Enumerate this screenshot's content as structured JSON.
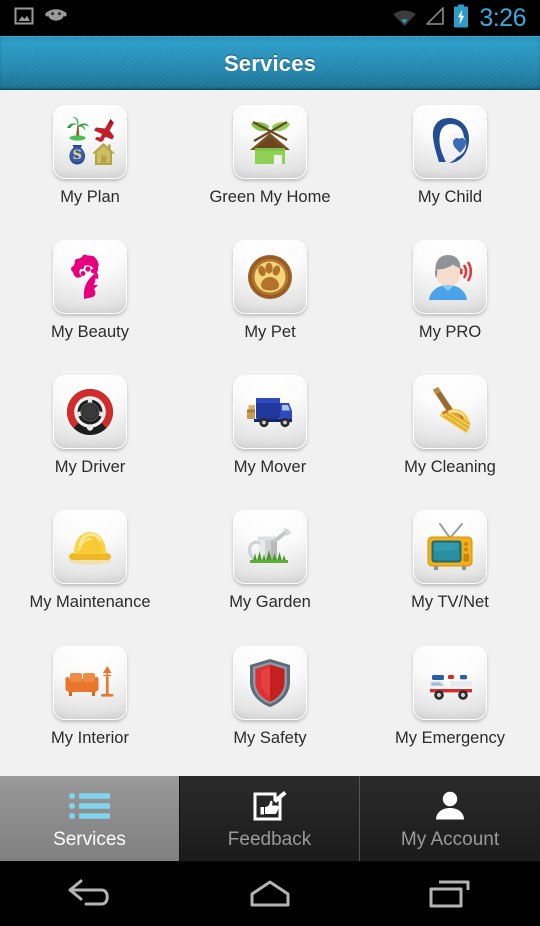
{
  "statusbar": {
    "left_icons": [
      "screenshot-icon",
      "cyanogenmod-android-icon"
    ],
    "right_icons": [
      "wifi-icon",
      "cellular-signal-icon",
      "battery-charging-icon"
    ],
    "clock": "3:26",
    "clock_color": "#3aa8d8"
  },
  "titlebar": {
    "title": "Services",
    "background_color": "#2688b0"
  },
  "grid": {
    "rows": [
      [
        {
          "icon": "my-plan-icon",
          "label": "My Plan"
        },
        {
          "icon": "green-my-home-icon",
          "label": "Green My Home"
        },
        {
          "icon": "my-child-icon",
          "label": "My Child"
        }
      ],
      [
        {
          "icon": "my-beauty-icon",
          "label": "My Beauty"
        },
        {
          "icon": "my-pet-icon",
          "label": "My Pet"
        },
        {
          "icon": "my-pro-icon",
          "label": "My PRO"
        }
      ],
      [
        {
          "icon": "my-driver-icon",
          "label": "My Driver"
        },
        {
          "icon": "my-mover-icon",
          "label": "My Mover"
        },
        {
          "icon": "my-cleaning-icon",
          "label": "My Cleaning"
        }
      ],
      [
        {
          "icon": "my-maintenance-icon",
          "label": "My Maintenance"
        },
        {
          "icon": "my-garden-icon",
          "label": "My Garden"
        },
        {
          "icon": "my-tv-net-icon",
          "label": "My TV/Net"
        }
      ],
      [
        {
          "icon": "my-interior-icon",
          "label": "My Interior"
        },
        {
          "icon": "my-safety-icon",
          "label": "My Safety"
        },
        {
          "icon": "my-emergency-icon",
          "label": "My Emergency"
        }
      ]
    ]
  },
  "tabbar": {
    "tabs": [
      {
        "icon": "list-icon",
        "label": "Services",
        "active": true
      },
      {
        "icon": "feedback-icon",
        "label": "Feedback",
        "active": false
      },
      {
        "icon": "person-icon",
        "label": "My Account",
        "active": false
      }
    ],
    "active_text_color": "#ffffff",
    "inactive_text_color": "#9a9a9a",
    "active_icon_color": "#7fd4f0"
  },
  "navbar": {
    "buttons": [
      "back-icon",
      "home-icon",
      "recents-icon"
    ]
  }
}
